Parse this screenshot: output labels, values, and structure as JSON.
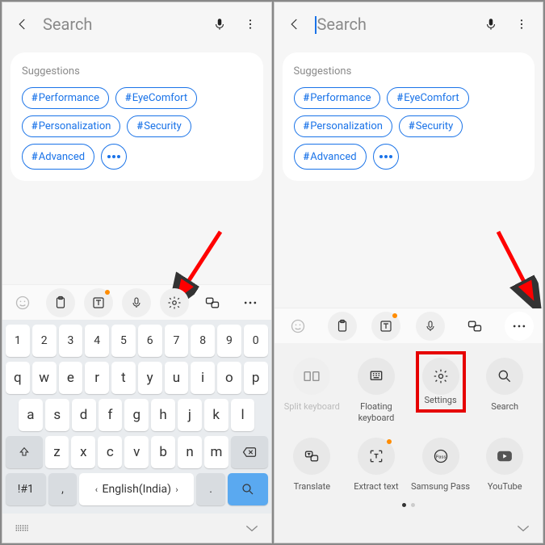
{
  "left": {
    "search_placeholder": "Search",
    "suggestions_title": "Suggestions",
    "chips": [
      "Performance",
      "EyeComfort",
      "Personalization",
      "Security",
      "Advanced"
    ],
    "keyboard": {
      "row_numbers": [
        "1",
        "2",
        "3",
        "4",
        "5",
        "6",
        "7",
        "8",
        "9",
        "0"
      ],
      "row_q": [
        "q",
        "w",
        "e",
        "r",
        "t",
        "y",
        "u",
        "i",
        "o",
        "p"
      ],
      "row_a": [
        "a",
        "s",
        "d",
        "f",
        "g",
        "h",
        "j",
        "k",
        "l"
      ],
      "row_z": [
        "z",
        "x",
        "c",
        "v",
        "b",
        "n",
        "m"
      ],
      "sym_key": "!#1",
      "comma": ",",
      "lang_label": "English(India)",
      "period": "."
    }
  },
  "right": {
    "search_placeholder": "Search",
    "suggestions_title": "Suggestions",
    "chips": [
      "Performance",
      "EyeComfort",
      "Personalization",
      "Security",
      "Advanced"
    ],
    "more_items": [
      {
        "label": "Split keyboard",
        "icon": "split",
        "disabled": true
      },
      {
        "label": "Floating keyboard",
        "icon": "floating",
        "badge": false
      },
      {
        "label": "Settings",
        "icon": "gear",
        "highlight": true
      },
      {
        "label": "Search",
        "icon": "search"
      },
      {
        "label": "Translate",
        "icon": "translate"
      },
      {
        "label": "Extract text",
        "icon": "extract",
        "badge": true
      },
      {
        "label": "Samsung Pass",
        "icon": "pass"
      },
      {
        "label": "YouTube",
        "icon": "youtube"
      }
    ]
  }
}
